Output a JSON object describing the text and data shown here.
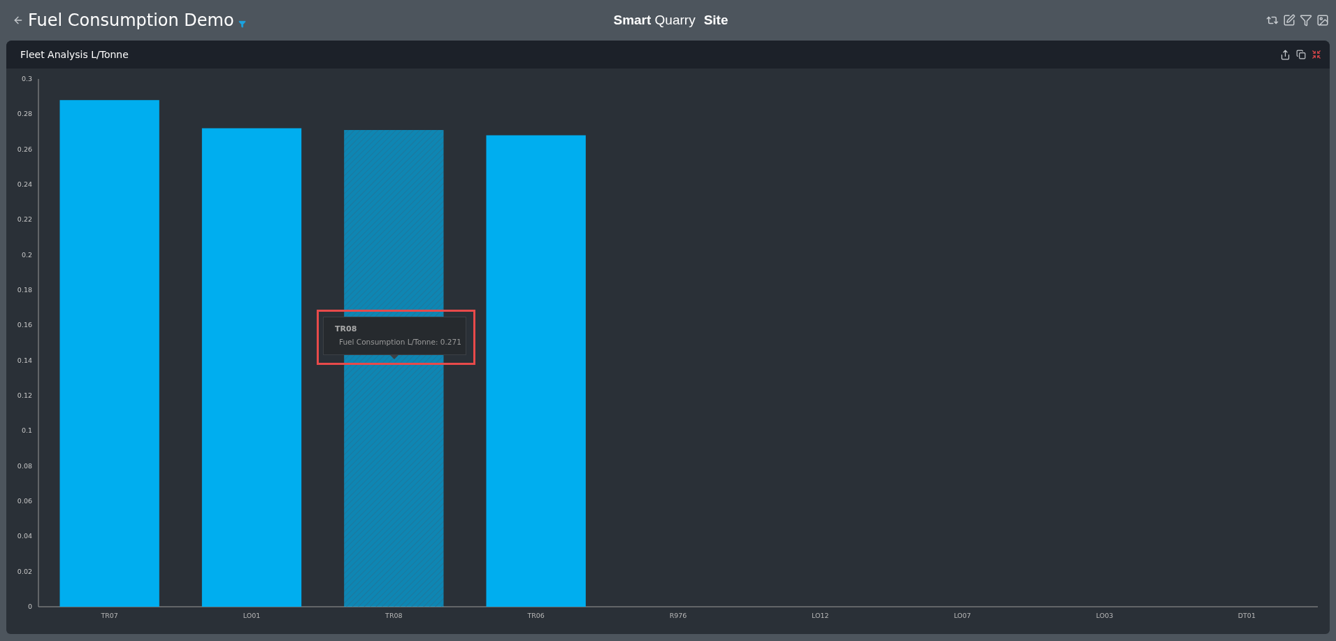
{
  "header": {
    "title": "Fuel Consumption Demo",
    "filter_active": true,
    "logo": "**Smart** Quarry",
    "site": "Site"
  },
  "panel": {
    "title": "Fleet Analysis L/Tonne",
    "chart_data": {
      "type": "bar",
      "categories": [
        "TR07",
        "LO01",
        "TR08",
        "TR06",
        "R976",
        "LO12",
        "LO07",
        "LO03",
        "DT01"
      ],
      "series": [
        {
          "name": "Fuel Consumption L/Tonne",
          "color": "#00aeef",
          "values": [
            0.288,
            0.272,
            0.271,
            0.268,
            null,
            null,
            null,
            null,
            null
          ]
        }
      ],
      "ylim": [
        0,
        0.3
      ],
      "yticks": [
        0,
        0.02,
        0.04,
        0.06,
        0.08,
        0.1,
        0.12,
        0.14,
        0.16,
        0.18,
        0.2,
        0.22,
        0.24,
        0.26,
        0.28,
        0.3
      ]
    },
    "bar_states": [
      {
        "hovered": false
      },
      {
        "hovered": false
      },
      {
        "hovered": true
      },
      {
        "hovered": false
      }
    ],
    "tooltip": {
      "title": "TR08",
      "separator": ":",
      "value": "0.271",
      "highlighted": true
    }
  }
}
